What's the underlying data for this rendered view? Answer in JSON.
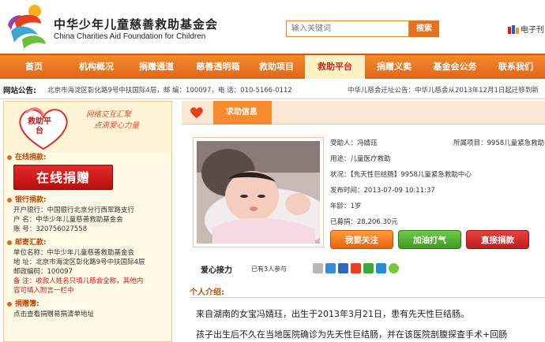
{
  "header": {
    "brand_cn": "中华少年儿童慈善救助基金会",
    "brand_en": "China Charities Aid Foundation for Children",
    "search_placeholder": "输入关键词",
    "search_button": "搜索",
    "top_link": "电子刊"
  },
  "nav": {
    "items": [
      {
        "label": "首页",
        "active": false
      },
      {
        "label": "机构概况",
        "active": false
      },
      {
        "label": "捐赠通道",
        "active": false
      },
      {
        "label": "慈善透明箱",
        "active": false
      },
      {
        "label": "救助项目",
        "active": false
      },
      {
        "label": "救助平台",
        "active": true
      },
      {
        "label": "捐赠义卖",
        "active": false
      },
      {
        "label": "基金会公务",
        "active": false
      },
      {
        "label": "联系我们",
        "active": false
      }
    ]
  },
  "notice": {
    "label": "网站公告:",
    "text": "北京市海淀区彰化路9号中扶国际4层，邮 编：100097，电 话：010-5166-0112",
    "text2": "中华儿慈会迁址公告：中华儿慈会从2013年12月1日起迁移到新"
  },
  "sidebar": {
    "promo_heart_text": "救助平台",
    "promo_slogan_1": "网络交互汇聚",
    "promo_slogan_2": "点滴爱心力量",
    "online_donate_title": "在线捐款:",
    "online_donate_button": "在线捐赠",
    "bank_title": "银行捐款:",
    "bank_lines": [
      "开户银行：中国银行北京分行西翠路支行",
      "户  名：中华少年儿童慈善救助基金会",
      "账  号：320756027558"
    ],
    "post_title": "邮寄汇款:",
    "post_lines": [
      "单位名称：中华少年儿童慈善救助基金会",
      "地  址：北京市海淀区彰化路9号中扶国际4层",
      "邮政编码：100097"
    ],
    "post_note_1": "备  注：收款人姓名只填儿慈会全称，其他内",
    "post_note_2": "容可填入附言一栏中",
    "donate_book_title": "捐赠簿:",
    "donate_book_line": "点击查看捐赠易捐清单地址"
  },
  "main": {
    "tab_title": "求助信息",
    "info": {
      "recipient": "受助人：冯婧珏",
      "project": "所属项目：9958儿童紧急救助",
      "purpose": "用途：儿童医疗救助",
      "status": "状况：【先天性巨结肠】9958儿童紧急救助中心",
      "publish_time": "发布时间：2013-07-09 10:11:37",
      "age": "年龄：1岁",
      "raised": "已募捐：28,206.30元"
    },
    "buttons": {
      "follow": "我要关注",
      "cheer": "加油打气",
      "donate": "直接捐款"
    },
    "relay_title": "爱心接力",
    "relay_count": "已有3人参与",
    "intro_label": "个人介绍:",
    "intro_text1": "来自湖南的女宝冯婧珏，出生于2013年3月21日，患有先天性巨结肠。",
    "intro_text2": "孩子出生后不久在当地医院确诊为先天性巨结肠，并在该医院剖腹探查手术+回肠"
  },
  "colors": {
    "accent": "#f58b2c",
    "nav": "#e0661a",
    "brand_red": "#c01818"
  },
  "icons": [
    "logo-mark",
    "magazine-icon",
    "heart-icon",
    "share-icons"
  ]
}
